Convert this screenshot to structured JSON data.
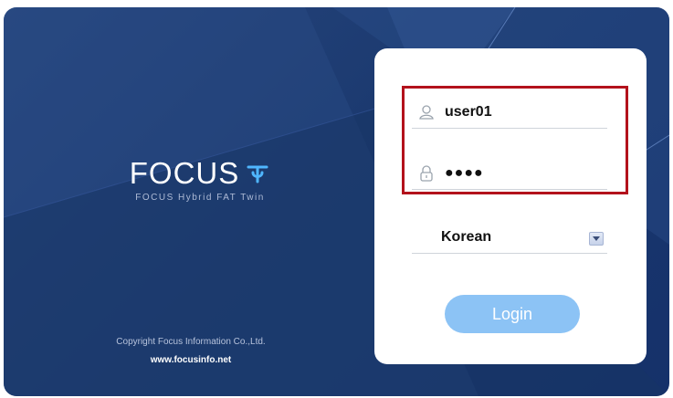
{
  "brand": {
    "name": "FOCUS",
    "tagline": "FOCUS Hybrid FAT Twin"
  },
  "footer": {
    "copyright": "Copyright Focus Information Co.,Ltd.",
    "website": "www.focusinfo.net"
  },
  "login_form": {
    "username": "user01",
    "password_mask": "●●●●",
    "language": "Korean",
    "login_label": "Login"
  },
  "icons": {
    "user": "user-icon",
    "lock": "lock-icon",
    "dropdown": "chevron-down-icon",
    "logo": "focus-logo-icon"
  },
  "colors": {
    "background": "#1f3d74",
    "highlight_border": "#b3121c",
    "login_button": "#8cc3f5"
  }
}
